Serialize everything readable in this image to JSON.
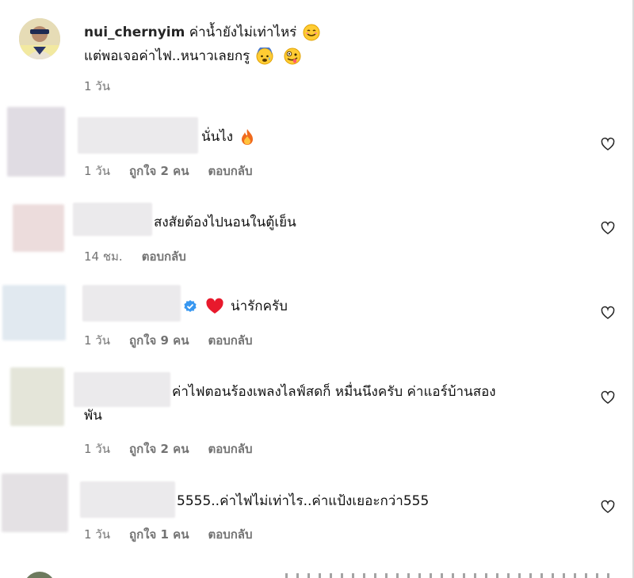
{
  "main_comment": {
    "username": "nui_chernyim",
    "line1": "ค่าน้ำยังไม่เท่าไหร่",
    "line2": "แต่พอเจอค่าไฟ..หนาวเลยกรู",
    "time": "1 วัน",
    "emojis": [
      "smiling-face",
      "anxious-face",
      "zany-face"
    ]
  },
  "replies": [
    {
      "text": "นั่นไง",
      "time": "1 วัน",
      "likes": "ถูกใจ 2 คน",
      "reply": "ตอบกลับ",
      "emoji": "fire"
    },
    {
      "text": "สงสัยต้องไปนอนในตู้เย็น",
      "time": "14 ชม.",
      "likes": "",
      "reply": "ตอบกลับ"
    },
    {
      "text": "น่ารักครับ",
      "time": "1 วัน",
      "likes": "ถูกใจ 9 คน",
      "reply": "ตอบกลับ",
      "badge": "verified",
      "emoji": "red-heart"
    },
    {
      "text_line1": "ค่าไฟตอนร้องเพลงไลฟ์สดก็ หมื่นนึงครับ ค่าแอร์บ้านสอง",
      "text_line2": "พัน",
      "time": "1 วัน",
      "likes": "ถูกใจ 2 คน",
      "reply": "ตอบกลับ"
    },
    {
      "text": "5555..ค่าไฟไม่เท่าไร..ค่าแป้งเยอะกว่า555",
      "time": "1 วัน",
      "likes": "ถูกใจ 1 คน",
      "reply": "ตอบกลับ"
    }
  ],
  "colors": {
    "meta": "#737373",
    "heart_red": "#e8192c",
    "verified_blue": "#3897f0"
  }
}
